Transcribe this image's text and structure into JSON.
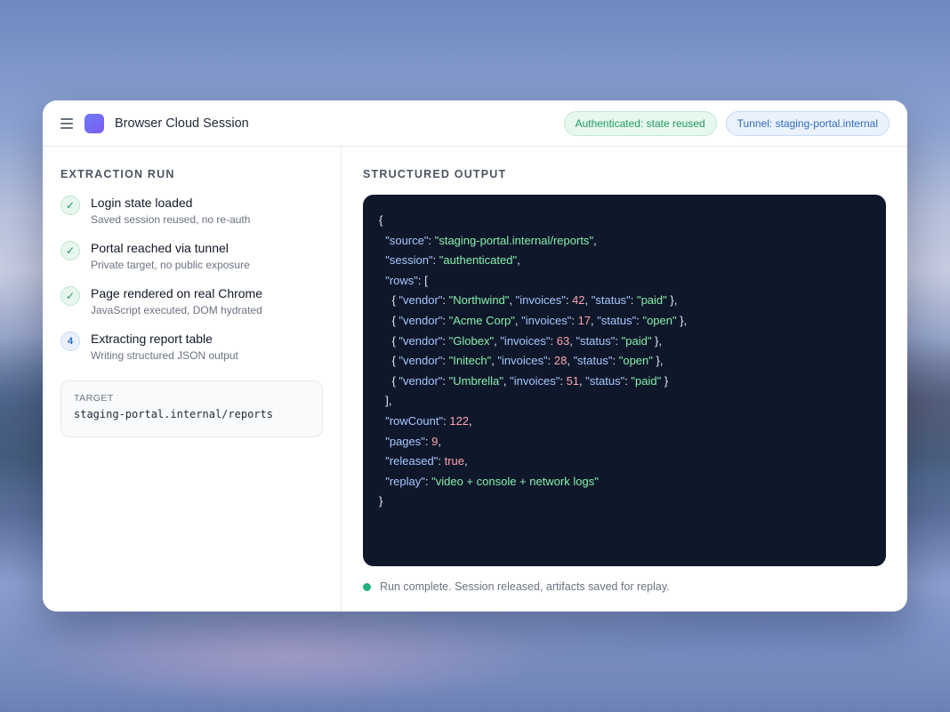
{
  "header": {
    "title": "Browser Cloud Session",
    "menu_icon": "hamburger-menu-icon",
    "logo_color": "#6d7cf5",
    "auth_pill": "Authenticated: state reused",
    "tunnel_pill": "Tunnel: staging-portal.internal"
  },
  "left": {
    "section_title": "EXTRACTION RUN",
    "steps": [
      {
        "badge": "✓",
        "title": "Login state loaded",
        "desc": "Saved session reused, no re-auth",
        "state": "done"
      },
      {
        "badge": "✓",
        "title": "Portal reached via tunnel",
        "desc": "Private target, no public exposure",
        "state": "done"
      },
      {
        "badge": "✓",
        "title": "Page rendered on real Chrome",
        "desc": "JavaScript executed, DOM hydrated",
        "state": "done"
      },
      {
        "badge": "4",
        "title": "Extracting report table",
        "desc": "Writing structured JSON output",
        "state": "active"
      }
    ],
    "target": {
      "label": "TARGET",
      "value": "staging-portal.internal/reports"
    }
  },
  "right": {
    "section_title": "STRUCTURED OUTPUT",
    "output": {
      "source": "staging-portal.internal/reports",
      "session": "authenticated",
      "rows": [
        {
          "vendor": "Northwind",
          "invoices": 42,
          "status": "paid"
        },
        {
          "vendor": "Acme Corp",
          "invoices": 17,
          "status": "open"
        },
        {
          "vendor": "Globex",
          "invoices": 63,
          "status": "paid"
        },
        {
          "vendor": "Initech",
          "invoices": 28,
          "status": "open"
        },
        {
          "vendor": "Umbrella",
          "invoices": 51,
          "status": "paid"
        }
      ],
      "rowCount": 122,
      "pages": 9,
      "released": "true",
      "replay": "video + console + network logs"
    },
    "status_text": "Run complete. Session released, artifacts saved for replay.",
    "status_color": "#22b07d"
  }
}
